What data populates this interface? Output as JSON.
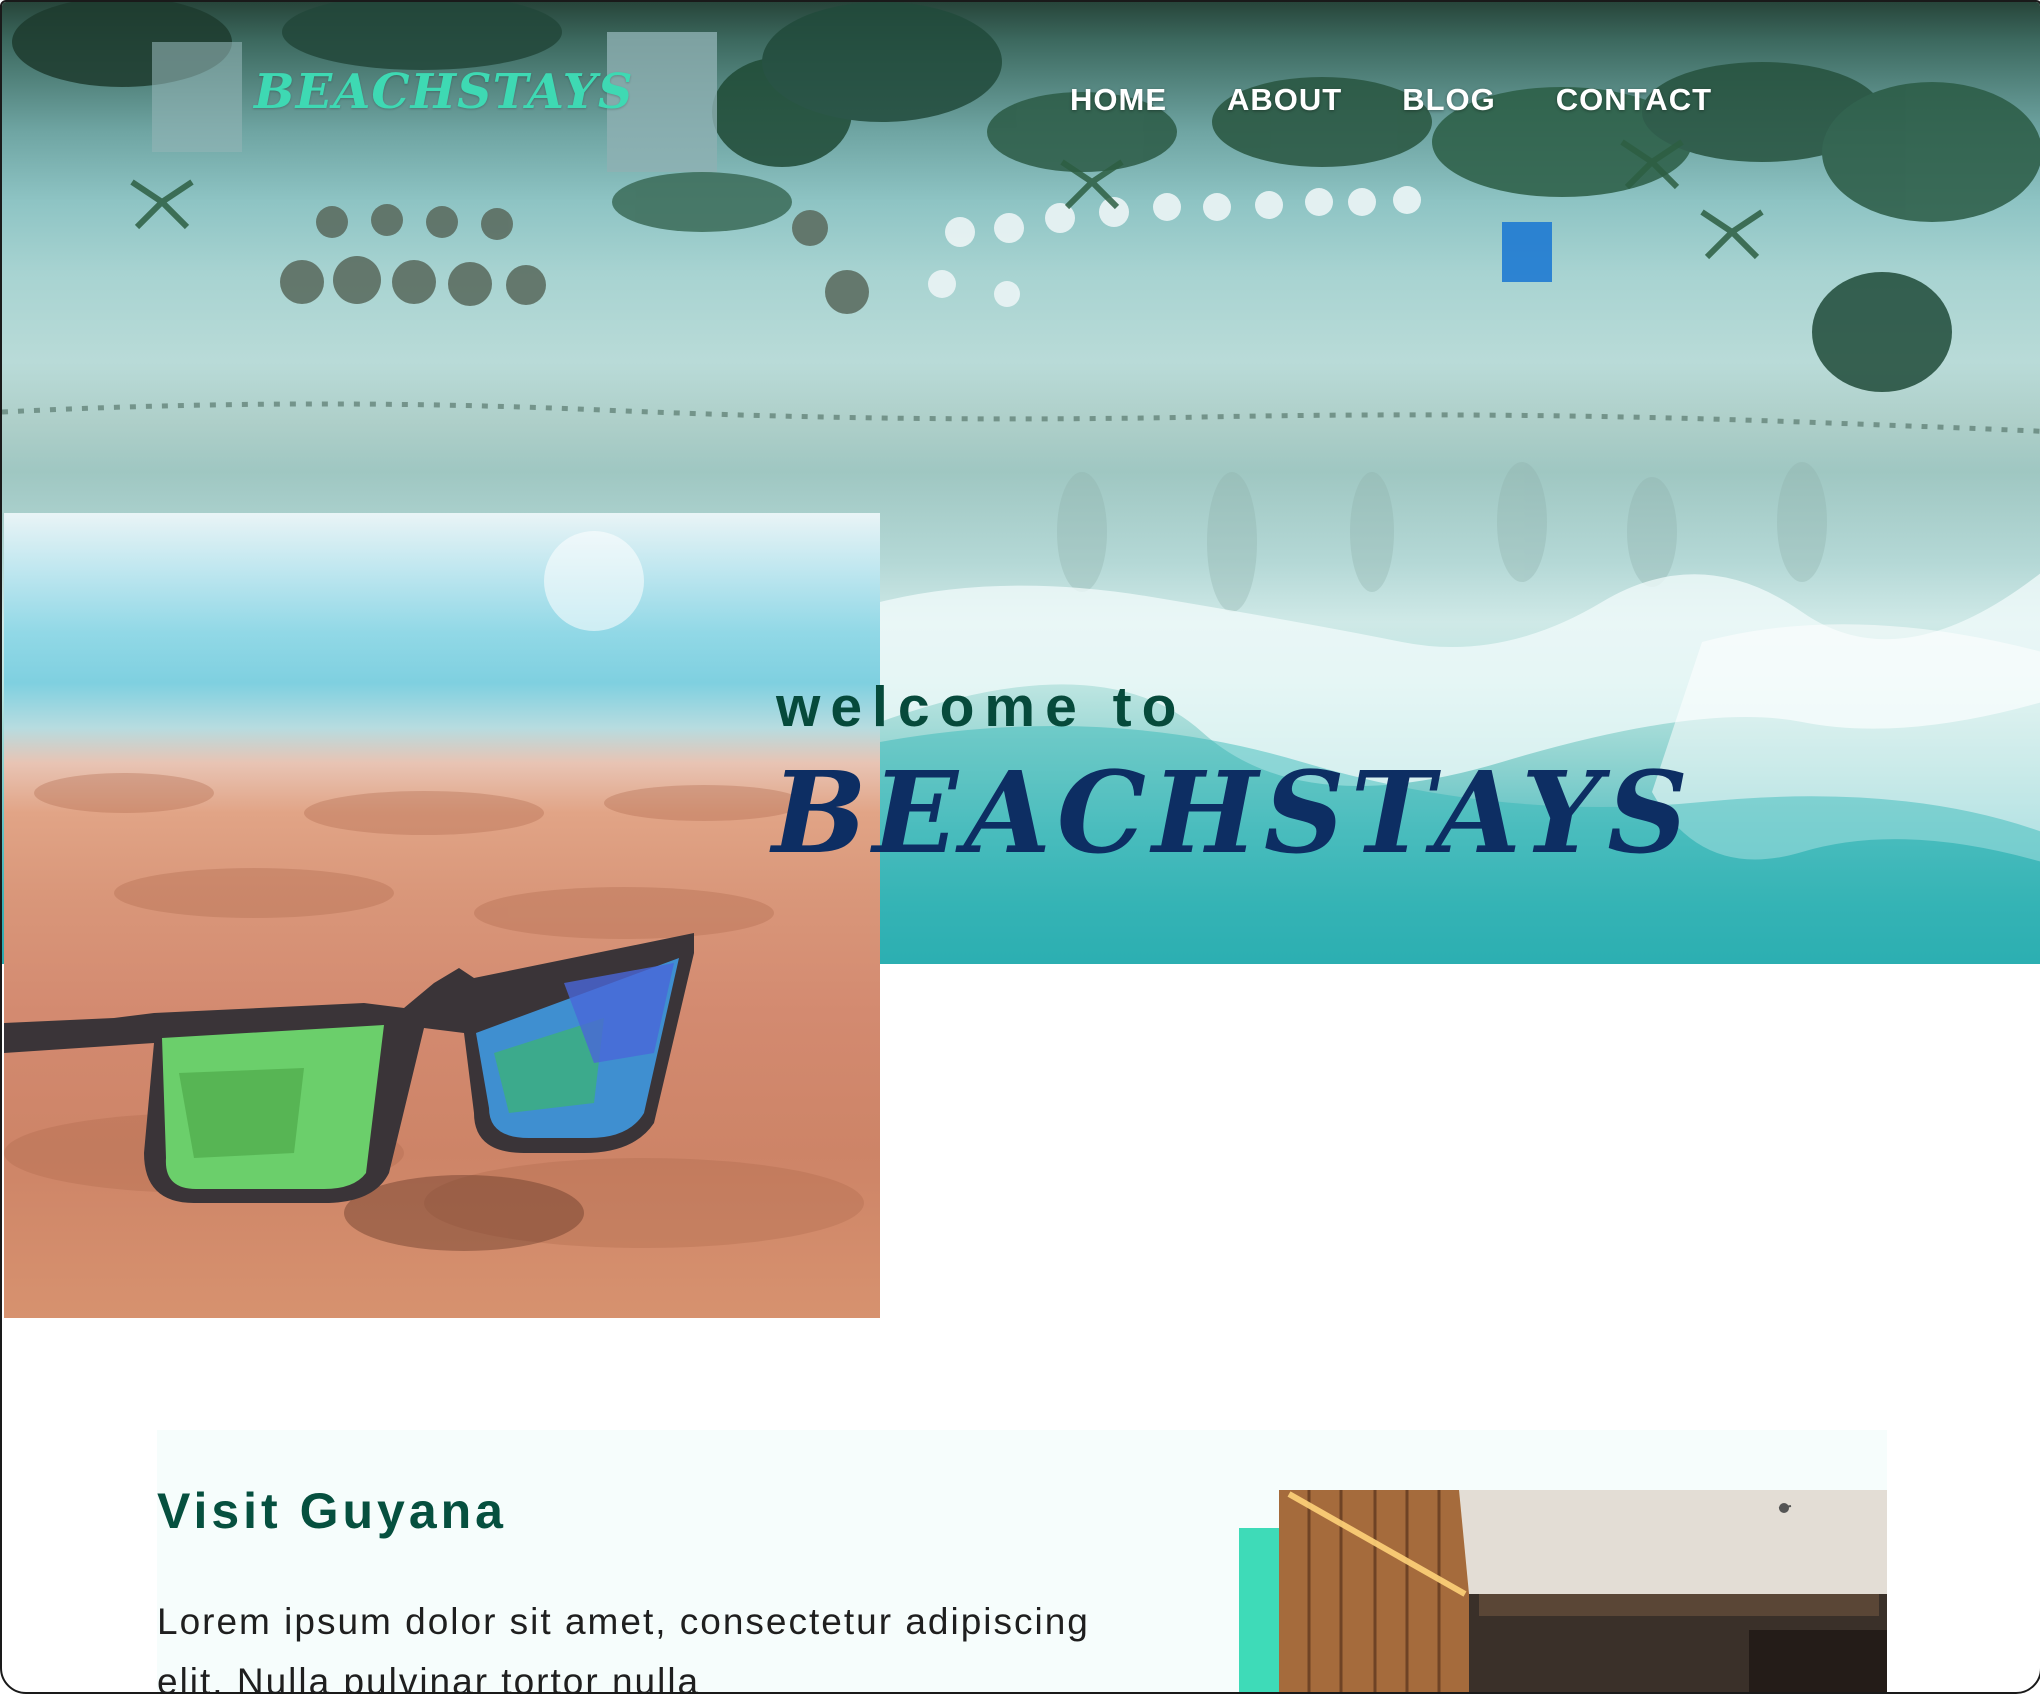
{
  "header": {
    "logo": "BEACHSTAYS",
    "nav": [
      {
        "label": "HOME"
      },
      {
        "label": "ABOUT"
      },
      {
        "label": "BLOG"
      },
      {
        "label": "CONTACT"
      }
    ]
  },
  "hero": {
    "welcome_line": "welcome to",
    "brand_line": "BEACHSTAYS"
  },
  "visit": {
    "title": "Visit Guyana",
    "body": "Lorem ipsum dolor sit amet, consectetur adipiscing elit. Nulla pulvinar tortor nulla"
  },
  "colors": {
    "logo": "#3ed9b3",
    "welcome_text": "#064a3b",
    "brand_text": "#0d2e63",
    "accent": "#3edbb8",
    "section_title": "#06503f"
  }
}
